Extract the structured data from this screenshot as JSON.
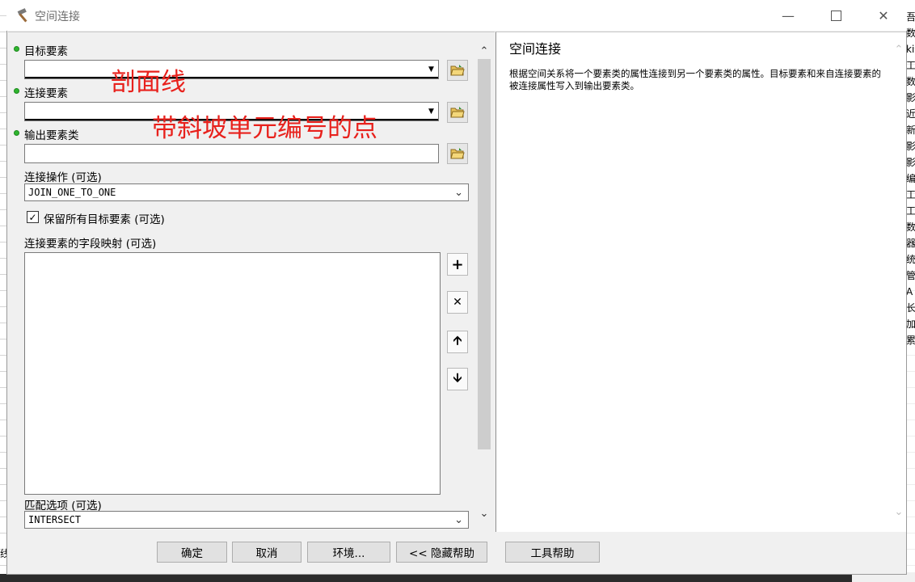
{
  "window": {
    "title": "空间连接",
    "icon": "hammer-icon"
  },
  "form": {
    "target_label": "目标要素",
    "join_label": "连接要素",
    "output_label": "输出要素类",
    "operation_label": "连接操作 (可选)",
    "operation_value": "JOIN_ONE_TO_ONE",
    "keep_all_label": "保留所有目标要素 (可选)",
    "keep_all_checked": true,
    "field_map_label": "连接要素的字段映射 (可选)",
    "match_label": "匹配选项 (可选)",
    "match_value": "INTERSECT"
  },
  "annotations": {
    "target_note": "剖面线",
    "join_note": "带斜坡单元编号的点"
  },
  "help": {
    "title": "空间连接",
    "body": "根据空间关系将一个要素类的属性连接到另一个要素类的属性。目标要素和来自连接要素的被连接属性写入到输出要素类。"
  },
  "buttons": {
    "ok": "确定",
    "cancel": "取消",
    "env": "环境...",
    "hide_help": "<< 隐藏帮助",
    "tool_help": "工具帮助"
  },
  "background": {
    "left_char": "线",
    "right_chars": [
      "吾",
      "数",
      "ki",
      "工",
      "数",
      "影",
      "近",
      "新",
      "影",
      "影",
      "编",
      "工",
      "工",
      "数",
      "器",
      "统",
      "管",
      "A",
      "长",
      "加",
      "累"
    ]
  },
  "colors": {
    "required_dot": "#2fb52f",
    "annotation": "#e8211c"
  }
}
